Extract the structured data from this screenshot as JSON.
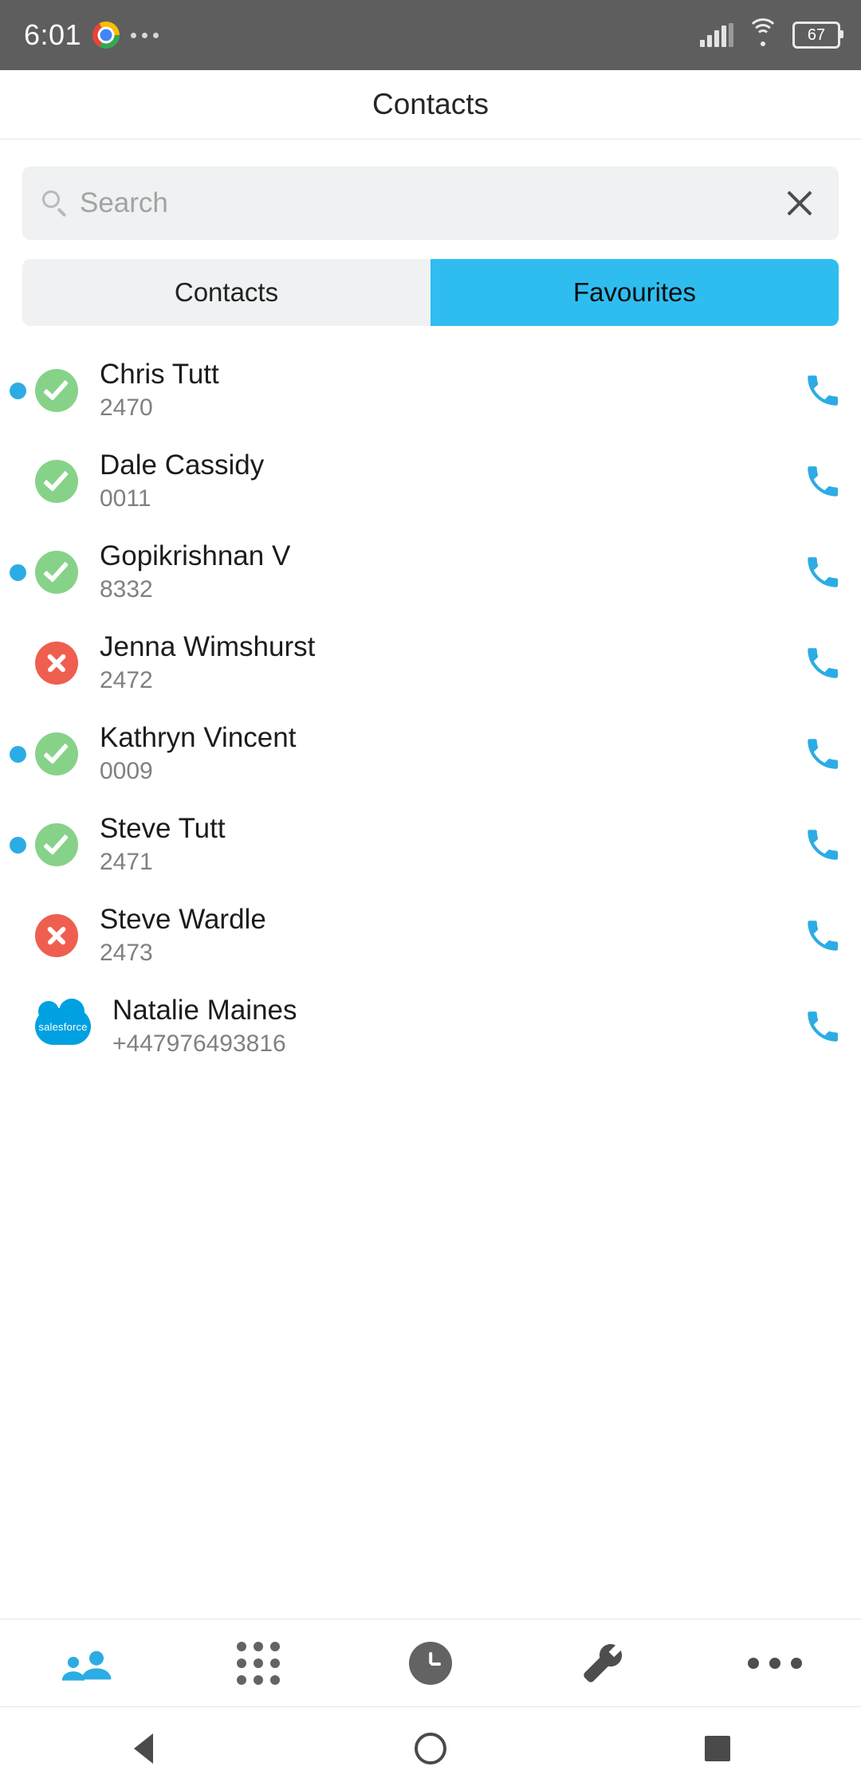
{
  "status_bar": {
    "time": "6:01",
    "chrome_icon": "chrome-icon",
    "overflow_icon": "more-dots-icon",
    "signal_icon": "cellular-signal-icon",
    "wifi_icon": "wifi-icon",
    "battery_level": "67"
  },
  "header": {
    "title": "Contacts"
  },
  "search": {
    "placeholder": "Search",
    "value": "",
    "search_icon": "search-icon",
    "clear_icon": "close-icon"
  },
  "tabs": {
    "items": [
      {
        "label": "Contacts",
        "active": false
      },
      {
        "label": "Favourites",
        "active": true
      }
    ]
  },
  "colors": {
    "accent_blue": "#2fbdf0",
    "presence_blue": "#2cace4",
    "available_green": "#87d289",
    "busy_red": "#ef5f4f",
    "salesforce_blue": "#00a1e0",
    "status_bar_gray": "#5e5e5e",
    "field_gray": "#eff1f2"
  },
  "contacts": [
    {
      "name": "Chris Tutt",
      "number": "2470",
      "avatar": "check-avatar",
      "status": "available",
      "presence": true
    },
    {
      "name": "Dale Cassidy",
      "number": "0011",
      "avatar": "check-avatar",
      "status": "available",
      "presence": false
    },
    {
      "name": "Gopikrishnan V",
      "number": "8332",
      "avatar": "check-avatar",
      "status": "available",
      "presence": true
    },
    {
      "name": "Jenna Wimshurst",
      "number": "2472",
      "avatar": "cross-avatar",
      "status": "busy",
      "presence": false
    },
    {
      "name": "Kathryn Vincent",
      "number": "0009",
      "avatar": "check-avatar",
      "status": "available",
      "presence": true
    },
    {
      "name": "Steve Tutt",
      "number": "2471",
      "avatar": "check-avatar",
      "status": "available",
      "presence": true
    },
    {
      "name": "Steve Wardle",
      "number": "2473",
      "avatar": "cross-avatar",
      "status": "busy",
      "presence": false
    },
    {
      "name": "Natalie Maines",
      "number": "+447976493816",
      "avatar": "salesforce-avatar",
      "status": "salesforce",
      "presence": false,
      "avatar_label": "salesforce"
    }
  ],
  "call_button_icon": "phone-icon",
  "bottom_nav": {
    "items": [
      {
        "icon": "contacts-people-icon",
        "active": true
      },
      {
        "icon": "dialpad-icon",
        "active": false
      },
      {
        "icon": "recents-clock-icon",
        "active": false
      },
      {
        "icon": "settings-wrench-icon",
        "active": false
      },
      {
        "icon": "more-ellipsis-icon",
        "active": false
      }
    ]
  },
  "android_nav": {
    "items": [
      {
        "icon": "back-triangle-icon"
      },
      {
        "icon": "home-circle-icon"
      },
      {
        "icon": "recents-square-icon"
      }
    ]
  }
}
